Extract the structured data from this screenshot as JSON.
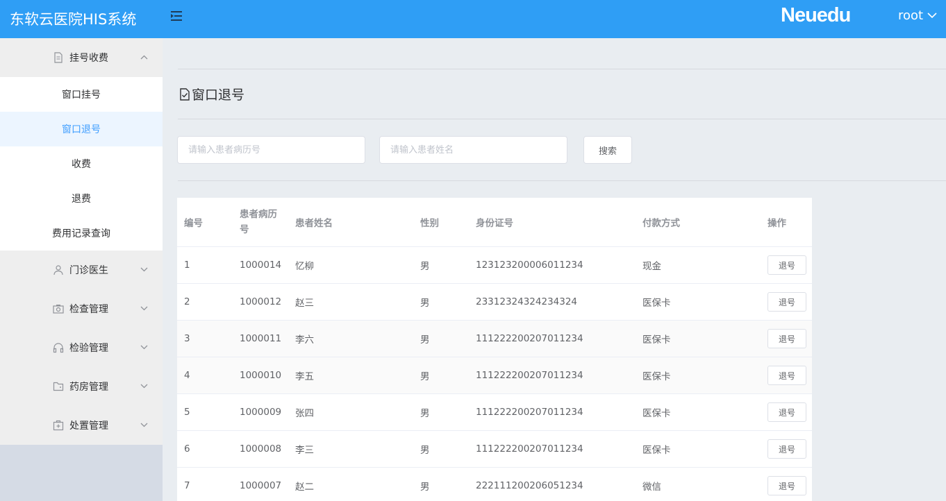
{
  "header": {
    "app_title": "东软云医院HIS系统",
    "brand": "Neuedu",
    "user": "root",
    "bg_color": "#2f9ef5"
  },
  "sidebar": {
    "groups": [
      {
        "label": "挂号收费",
        "icon": "document-icon",
        "expanded": true
      },
      {
        "label": "门诊医生",
        "icon": "user-icon",
        "expanded": false
      },
      {
        "label": "检查管理",
        "icon": "camera-icon",
        "expanded": false
      },
      {
        "label": "检验管理",
        "icon": "headset-icon",
        "expanded": false
      },
      {
        "label": "药房管理",
        "icon": "wallet-icon",
        "expanded": false
      },
      {
        "label": "处置管理",
        "icon": "first-aid-icon",
        "expanded": false
      }
    ],
    "submenu": [
      {
        "label": "窗口挂号",
        "active": false
      },
      {
        "label": "窗口退号",
        "active": true
      },
      {
        "label": "收费",
        "active": false
      },
      {
        "label": "退费",
        "active": false
      },
      {
        "label": "费用记录查询",
        "active": false
      }
    ],
    "active_color": "#409eff"
  },
  "page": {
    "title": "窗口退号",
    "search": {
      "case_placeholder": "请输入患者病历号",
      "name_placeholder": "请输入患者姓名",
      "case_value": "",
      "name_value": "",
      "button": "搜索"
    }
  },
  "table": {
    "headers": [
      "编号",
      "患者病历号",
      "患者姓名",
      "性别",
      "身份证号",
      "付款方式",
      "操作"
    ],
    "action_label": "退号",
    "rows": [
      {
        "no": "1",
        "case": "1000014",
        "name": "忆柳",
        "gender": "男",
        "id": "123123200006011234",
        "pay": "现金"
      },
      {
        "no": "2",
        "case": "1000012",
        "name": "赵三",
        "gender": "男",
        "id": "23312324324234324",
        "pay": "医保卡"
      },
      {
        "no": "3",
        "case": "1000011",
        "name": "李六",
        "gender": "男",
        "id": "111222200207011234",
        "pay": "医保卡"
      },
      {
        "no": "4",
        "case": "1000010",
        "name": "李五",
        "gender": "男",
        "id": "111222200207011234",
        "pay": "医保卡"
      },
      {
        "no": "5",
        "case": "1000009",
        "name": "张四",
        "gender": "男",
        "id": "111222200207011234",
        "pay": "医保卡"
      },
      {
        "no": "6",
        "case": "1000008",
        "name": "李三",
        "gender": "男",
        "id": "111222200207011234",
        "pay": "医保卡"
      },
      {
        "no": "7",
        "case": "1000007",
        "name": "赵二",
        "gender": "男",
        "id": "222111200206051234",
        "pay": "微信"
      }
    ]
  }
}
